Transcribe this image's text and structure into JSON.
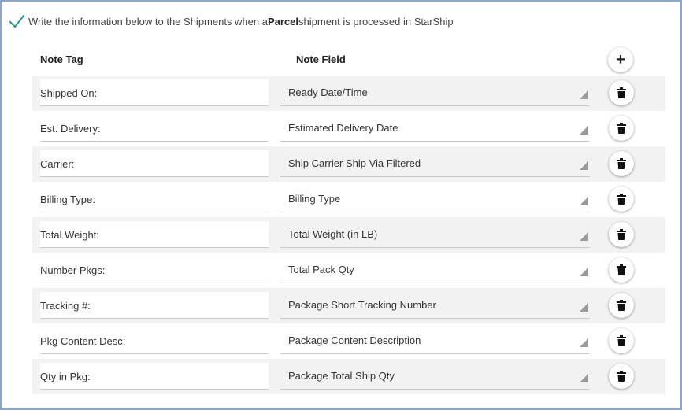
{
  "header": {
    "text_before": "Write the information below to the Shipments when a ",
    "bold_word": "Parcel",
    "text_after": " shipment is processed in StarShip",
    "checked": true
  },
  "columns": {
    "tag": "Note Tag",
    "field": "Note Field"
  },
  "add_button": {
    "icon": "plus-icon",
    "label": "+"
  },
  "rows": [
    {
      "tag": "Shipped On:",
      "field": "Ready Date/Time"
    },
    {
      "tag": "Est. Delivery:",
      "field": "Estimated Delivery Date"
    },
    {
      "tag": "Carrier:",
      "field": "Ship Carrier Ship Via Filtered"
    },
    {
      "tag": "Billing Type:",
      "field": "Billing Type"
    },
    {
      "tag": "Total Weight:",
      "field": "Total Weight (in LB)"
    },
    {
      "tag": "Number Pkgs:",
      "field": "Total Pack Qty"
    },
    {
      "tag": "Tracking #:",
      "field": "Package Short Tracking Number"
    },
    {
      "tag": "Pkg Content Desc:",
      "field": "Package Content Description"
    },
    {
      "tag": "Qty in Pkg:",
      "field": "Package Total Ship Qty"
    }
  ],
  "colors": {
    "border": "#8aa6cc",
    "check": "#2a9d8f",
    "row_alt": "#f2f2f2"
  },
  "icons": {
    "header": "checkmark-icon",
    "row_delete": "trash-icon",
    "select_corner": "dropdown-corner-icon"
  }
}
